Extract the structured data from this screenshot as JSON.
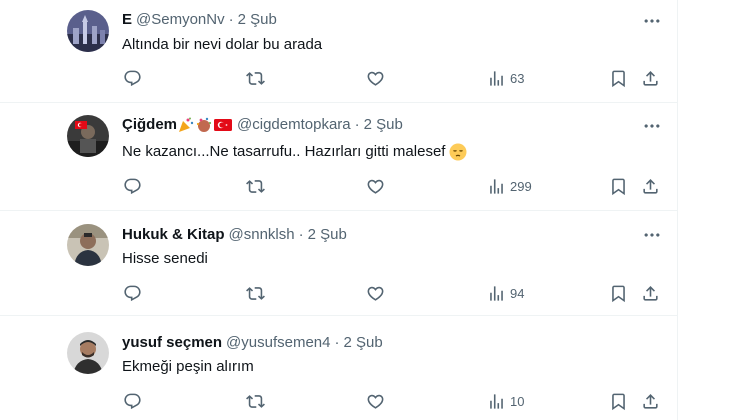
{
  "tweets": [
    {
      "name": "E",
      "handle": "@SemyonNv",
      "separator": "·",
      "date": "2 Şub",
      "text": "Altında bir nevi dolar bu arada",
      "views": "63"
    },
    {
      "name": "Çiğdem",
      "handle": "@cigdemtopkara",
      "separator": "·",
      "date": "2 Şub",
      "text": "Ne kazancı...Ne tasarrufu.. Hazırları gitti malesef",
      "views": "299"
    },
    {
      "name": "Hukuk & Kitap",
      "handle": "@snnklsh",
      "separator": "·",
      "date": "2 Şub",
      "text": "Hisse senedi",
      "views": "94"
    },
    {
      "name": "yusuf seçmen",
      "handle": "@yusufsemen4",
      "separator": "·",
      "date": "2 Şub",
      "text": "Ekmeği peşin alırım",
      "views": "10"
    }
  ],
  "icons": {
    "reply": "comment-bubble-icon",
    "retweet": "retweet-arrows-icon",
    "like": "heart-icon",
    "views": "bar-chart-icon",
    "bookmark": "bookmark-icon",
    "share": "share-upload-icon",
    "more": "more-dots-icon"
  },
  "colors": {
    "text_primary": "#0f1419",
    "text_secondary": "#536471",
    "divider": "#eff3f4",
    "flag_red": "#e30a17"
  }
}
